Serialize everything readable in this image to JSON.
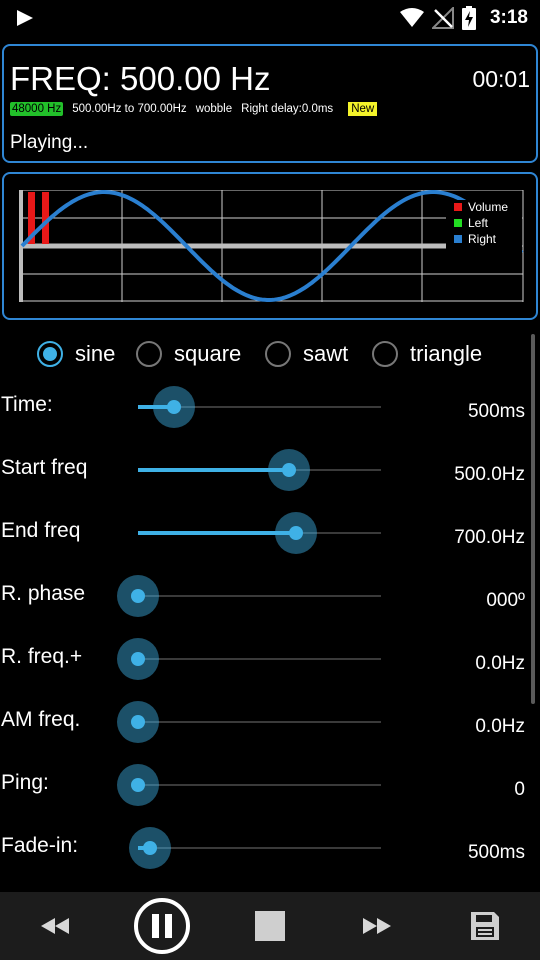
{
  "status_bar": {
    "time": "3:18",
    "icons": [
      "play-notification-icon",
      "wifi-icon",
      "no-signal-icon",
      "battery-charging-icon"
    ]
  },
  "info": {
    "freq_title": "FREQ: 500.00 Hz",
    "elapsed": "00:01",
    "sample_rate": "48000 Hz",
    "range": "500.00Hz to 700.00Hz",
    "mode": "wobble",
    "right_delay": "Right delay:0.0ms",
    "new_badge": "New",
    "status": "Playing..."
  },
  "graph": {
    "legend": [
      "Volume",
      "Left",
      "Right"
    ],
    "colors": {
      "volume": "#e81818",
      "left": "#22dd22",
      "right": "#2a7fd0",
      "grid": "#cfcfcf",
      "baseline": "#bdbdbd"
    }
  },
  "waveforms": {
    "options": [
      "sine",
      "square",
      "sawt",
      "triangle"
    ],
    "selected": "sine"
  },
  "sliders": [
    {
      "label": "Time:",
      "value": "500ms",
      "fraction": 0.15
    },
    {
      "label": "Start freq",
      "value": "500.0Hz",
      "fraction": 0.62
    },
    {
      "label": "End freq",
      "value": "700.0Hz",
      "fraction": 0.65
    },
    {
      "label": "R. phase",
      "value": "000º",
      "fraction": 0.0
    },
    {
      "label": "R. freq.+",
      "value": "0.0Hz",
      "fraction": 0.0
    },
    {
      "label": "AM freq.",
      "value": "0.0Hz",
      "fraction": 0.0
    },
    {
      "label": "Ping:",
      "value": "0",
      "fraction": 0.0
    },
    {
      "label": "Fade-in:",
      "value": "500ms",
      "fraction": 0.05
    }
  ],
  "bottom_bar": {
    "buttons": [
      "rewind-icon",
      "pause-icon",
      "stop-icon",
      "fast-forward-icon",
      "save-icon"
    ]
  },
  "accent": "#3fb1e6",
  "panel_border": "#2f86d4"
}
